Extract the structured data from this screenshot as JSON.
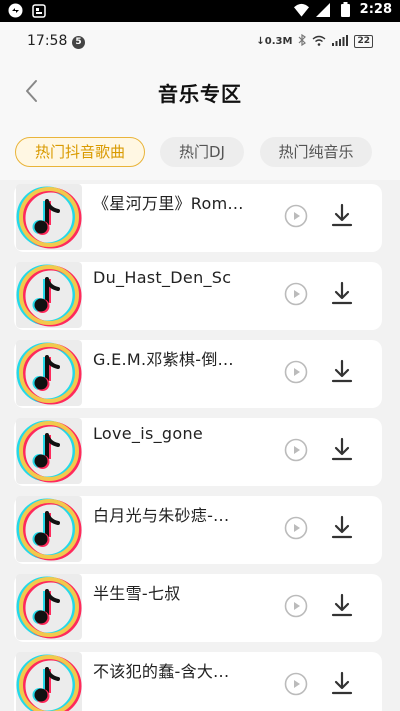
{
  "system": {
    "time": "2:28",
    "icons": [
      "cloud-sync-icon",
      "notification-icon",
      "wifi-icon",
      "cell-signal-icon",
      "battery-icon"
    ]
  },
  "app_status": {
    "time": "17:58",
    "badge": "5",
    "net_speed": "0.3M",
    "battery": "22"
  },
  "header": {
    "title": "音乐专区",
    "back_icon": "chevron-left-icon"
  },
  "tabs": [
    {
      "label": "热门抖音歌曲",
      "active": true
    },
    {
      "label": "热门DJ",
      "active": false
    },
    {
      "label": "热门纯音乐",
      "active": false
    }
  ],
  "songs": [
    {
      "title": "《星河万里》Rom..."
    },
    {
      "title": "Du_Hast_Den_Sc"
    },
    {
      "title": "G.E.M.邓紫棋-倒..."
    },
    {
      "title": "Love_is_gone"
    },
    {
      "title": "白月光与朱砂痣-..."
    },
    {
      "title": "半生雪-七叔"
    },
    {
      "title": "不该犯的蠢-含大..."
    }
  ],
  "colors": {
    "accent": "#e9b43a",
    "accent_text": "#d99a00",
    "background": "#f2f2f2",
    "card": "#ffffff"
  }
}
